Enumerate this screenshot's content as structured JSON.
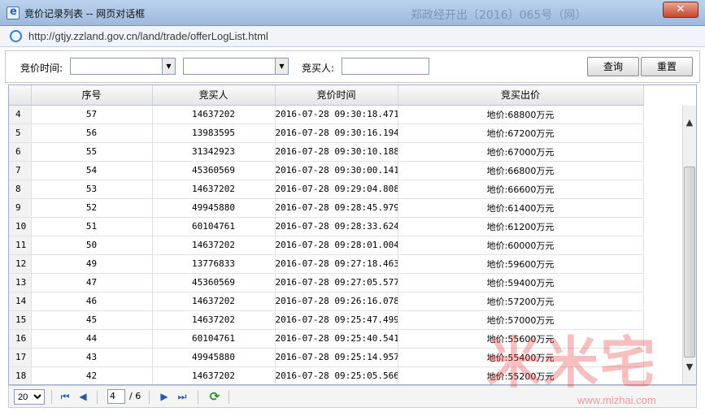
{
  "window": {
    "title": "竞价记录列表 -- 网页对话框",
    "background_text": "郑政经开出〔2016〕065号（网）",
    "close_label": "✕"
  },
  "address": {
    "url": "http://gtjy.zzland.gov.cn/land/trade/offerLogList.html"
  },
  "search": {
    "time_label": "竞价时间:",
    "buyer_label": "竞买人:",
    "start_value": "",
    "end_value": "",
    "buyer_value": "",
    "query_label": "查询",
    "reset_label": "重置"
  },
  "table": {
    "headers": [
      "序号",
      "竞买人",
      "竞价时间",
      "竞买出价"
    ],
    "rows": [
      {
        "rn": "4",
        "seq": "57",
        "buyer": "14637202",
        "time": "2016-07-28 09:30:18.471",
        "price": "地价:68800万元"
      },
      {
        "rn": "5",
        "seq": "56",
        "buyer": "13983595",
        "time": "2016-07-28 09:30:16.194",
        "price": "地价:67200万元"
      },
      {
        "rn": "6",
        "seq": "55",
        "buyer": "31342923",
        "time": "2016-07-28 09:30:10.188",
        "price": "地价:67000万元"
      },
      {
        "rn": "7",
        "seq": "54",
        "buyer": "45360569",
        "time": "2016-07-28 09:30:00.141",
        "price": "地价:66800万元"
      },
      {
        "rn": "8",
        "seq": "53",
        "buyer": "14637202",
        "time": "2016-07-28 09:29:04.808",
        "price": "地价:66600万元"
      },
      {
        "rn": "9",
        "seq": "52",
        "buyer": "49945880",
        "time": "2016-07-28 09:28:45.979",
        "price": "地价:61400万元"
      },
      {
        "rn": "10",
        "seq": "51",
        "buyer": "60104761",
        "time": "2016-07-28 09:28:33.624",
        "price": "地价:61200万元"
      },
      {
        "rn": "11",
        "seq": "50",
        "buyer": "14637202",
        "time": "2016-07-28 09:28:01.004",
        "price": "地价:60000万元"
      },
      {
        "rn": "12",
        "seq": "49",
        "buyer": "13776833",
        "time": "2016-07-28 09:27:18.463",
        "price": "地价:59600万元"
      },
      {
        "rn": "13",
        "seq": "47",
        "buyer": "45360569",
        "time": "2016-07-28 09:27:05.577",
        "price": "地价:59400万元"
      },
      {
        "rn": "14",
        "seq": "46",
        "buyer": "14637202",
        "time": "2016-07-28 09:26:16.078",
        "price": "地价:57200万元"
      },
      {
        "rn": "15",
        "seq": "45",
        "buyer": "14637202",
        "time": "2016-07-28 09:25:47.499",
        "price": "地价:57000万元"
      },
      {
        "rn": "16",
        "seq": "44",
        "buyer": "60104761",
        "time": "2016-07-28 09:25:40.541",
        "price": "地价:55600万元"
      },
      {
        "rn": "17",
        "seq": "43",
        "buyer": "49945880",
        "time": "2016-07-28 09:25:14.957",
        "price": "地价:55400万元"
      },
      {
        "rn": "18",
        "seq": "42",
        "buyer": "14637202",
        "time": "2016-07-28 09:25:05.566",
        "price": "地价:55200万元"
      }
    ]
  },
  "pager": {
    "page_size": "20",
    "page_size_options": [
      "20"
    ],
    "current_page": "4",
    "total_label": "/ 6"
  },
  "watermark": {
    "text": "米米宅",
    "url": "www.mizhai.com"
  }
}
